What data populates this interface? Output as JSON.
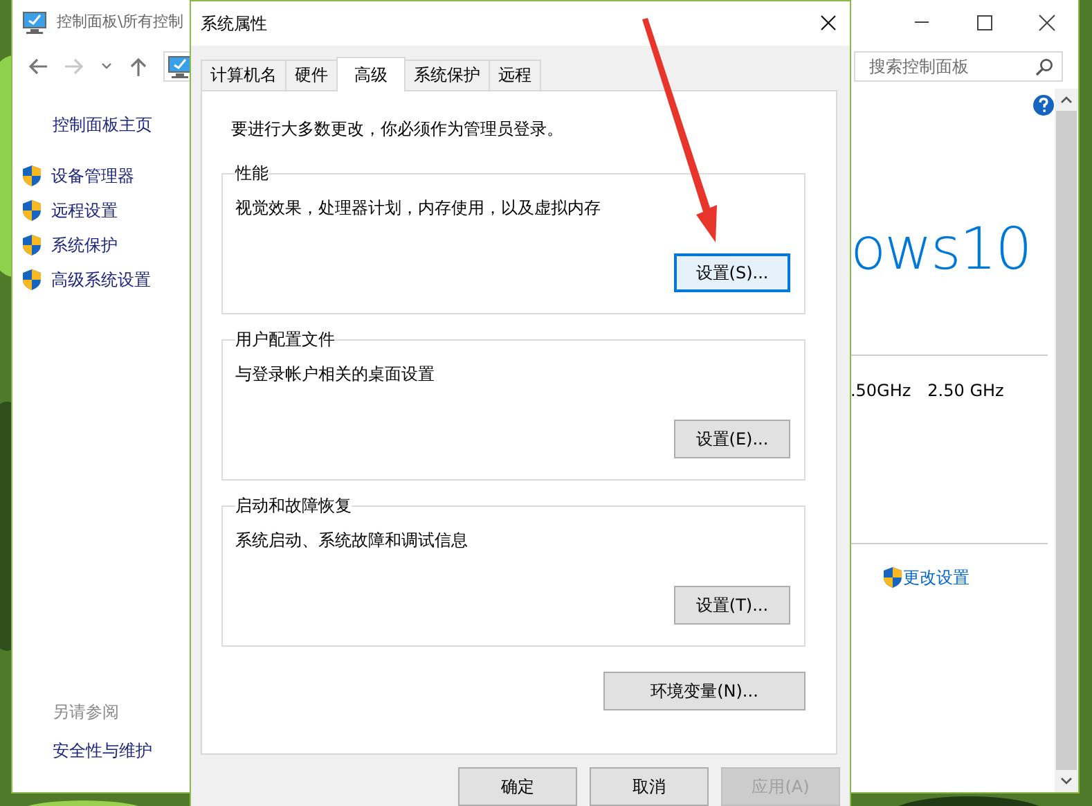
{
  "control_panel": {
    "title": "控制面板\\所有控制",
    "nav_buttons": [
      {
        "kind": "back",
        "disabled": false
      },
      {
        "kind": "forward",
        "disabled": true
      },
      {
        "kind": "recent",
        "disabled": false
      },
      {
        "kind": "up",
        "disabled": false
      }
    ],
    "search": {
      "placeholder": "搜索控制面板"
    },
    "sidebar": {
      "home": "控制面板主页",
      "items": [
        {
          "label": "设备管理器"
        },
        {
          "label": "远程设置"
        },
        {
          "label": "系统保护"
        },
        {
          "label": "高级系统设置"
        }
      ],
      "see_also_heading": "另请参阅",
      "see_also": [
        "安全性与维护"
      ]
    },
    "main": {
      "edition": "ows10",
      "processor_speed": ".50GHz",
      "processor_speed_2": "2.50 GHz",
      "change_settings": "更改设置"
    }
  },
  "dialog": {
    "title": "系统属性",
    "tabs": [
      {
        "label": "计算机名",
        "selected": false
      },
      {
        "label": "硬件",
        "selected": false
      },
      {
        "label": "高级",
        "selected": true
      },
      {
        "label": "系统保护",
        "selected": false
      },
      {
        "label": "远程",
        "selected": false
      }
    ],
    "admin_note": "要进行大多数更改，你必须作为管理员登录。",
    "groups": [
      {
        "title": "性能",
        "description": "视觉效果，处理器计划，内存使用，以及虚拟内存",
        "button": "设置(S)...",
        "focused": true
      },
      {
        "title": "用户配置文件",
        "description": "与登录帐户相关的桌面设置",
        "button": "设置(E)...",
        "focused": false
      },
      {
        "title": "启动和故障恢复",
        "description": "系统启动、系统故障和调试信息",
        "button": "设置(T)...",
        "focused": false
      }
    ],
    "env_button": "环境变量(N)...",
    "buttons": [
      {
        "label": "确定",
        "disabled": false
      },
      {
        "label": "取消",
        "disabled": false
      },
      {
        "label": "应用(A)",
        "disabled": true
      }
    ]
  },
  "annotation": {
    "kind": "arrow"
  }
}
